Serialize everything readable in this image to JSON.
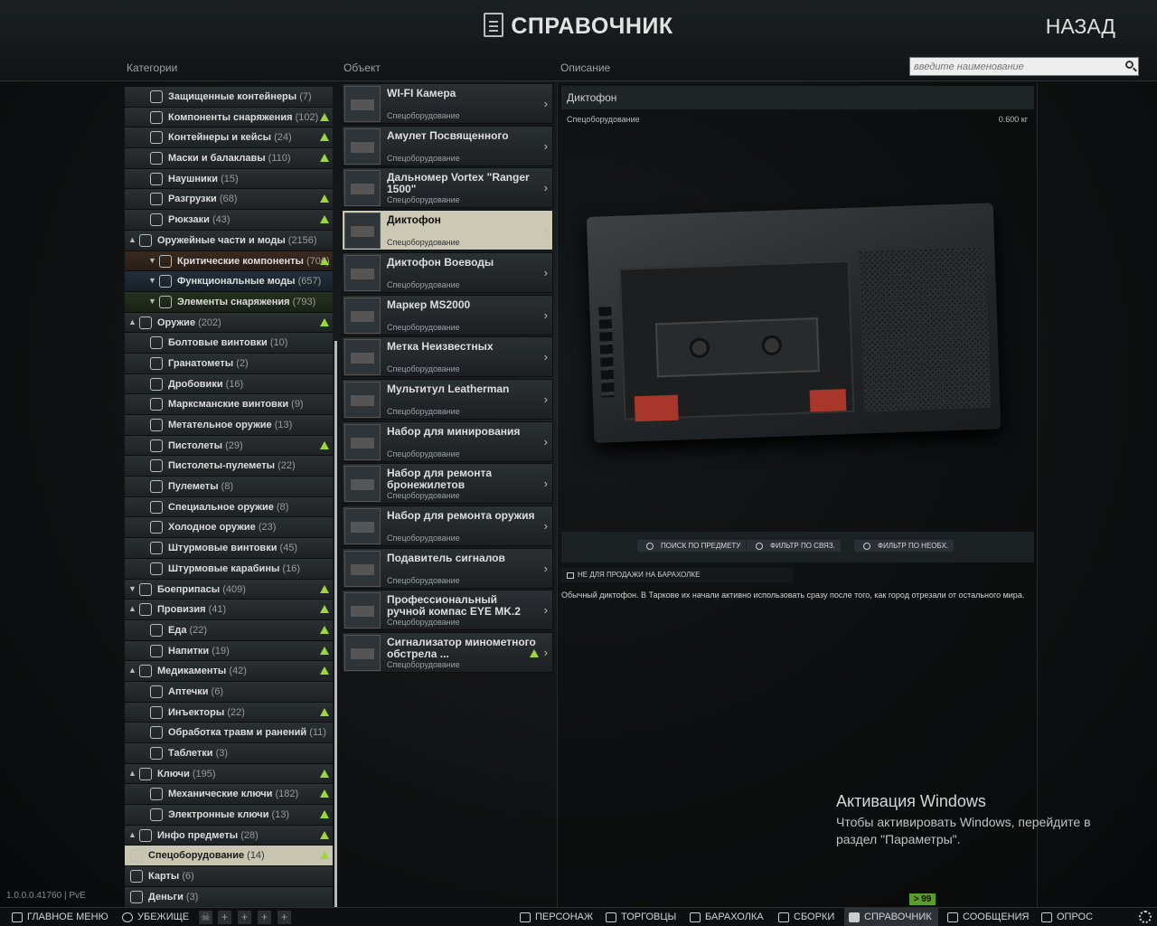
{
  "header": {
    "title": "СПРАВОЧНИК",
    "back_label": "НАЗАД",
    "col_categories": "Категории",
    "col_object": "Объект",
    "col_description": "Описание",
    "search_placeholder": "введите наименование"
  },
  "categories": [
    {
      "label": "Защищенные контейнеры",
      "count": "(7)",
      "level": 1,
      "icon": "container-icon",
      "warn": false
    },
    {
      "label": "Компоненты снаряжения",
      "count": "(102)",
      "level": 1,
      "icon": "gear-part-icon",
      "warn": true
    },
    {
      "label": "Контейнеры и кейсы",
      "count": "(24)",
      "level": 1,
      "icon": "case-icon",
      "warn": true
    },
    {
      "label": "Маски и балаклавы",
      "count": "(110)",
      "level": 1,
      "icon": "mask-icon",
      "warn": true
    },
    {
      "label": "Наушники",
      "count": "(15)",
      "level": 1,
      "icon": "headphones-icon",
      "warn": false
    },
    {
      "label": "Разгрузки",
      "count": "(68)",
      "level": 1,
      "icon": "vest-icon",
      "warn": true
    },
    {
      "label": "Рюкзаки",
      "count": "(43)",
      "level": 1,
      "icon": "backpack-icon",
      "warn": true
    },
    {
      "label": "Оружейные части и моды",
      "count": "(2156)",
      "level": 0,
      "icon": "weapon-mods-icon",
      "warn": false,
      "arrow": "^"
    },
    {
      "label": "Критические компоненты",
      "count": "(706)",
      "level": 2,
      "icon": "critical-icon",
      "warn": true,
      "arrow": "v",
      "style": "gold"
    },
    {
      "label": "Функциональные моды",
      "count": "(657)",
      "level": 2,
      "icon": "functional-icon",
      "warn": false,
      "arrow": "v",
      "style": "blue"
    },
    {
      "label": "Элементы снаряжения",
      "count": "(793)",
      "level": 2,
      "icon": "triangle-icon",
      "warn": false,
      "arrow": "v",
      "style": "green"
    },
    {
      "label": "Оружие",
      "count": "(202)",
      "level": 0,
      "icon": "weapon-icon",
      "warn": true,
      "arrow": "^"
    },
    {
      "label": "Болтовые винтовки",
      "count": "(10)",
      "level": 1,
      "icon": "rifle-icon",
      "warn": false
    },
    {
      "label": "Гранатометы",
      "count": "(2)",
      "level": 1,
      "icon": "launcher-icon",
      "warn": false
    },
    {
      "label": "Дробовики",
      "count": "(16)",
      "level": 1,
      "icon": "shotgun-icon",
      "warn": false
    },
    {
      "label": "Марксманские винтовки",
      "count": "(9)",
      "level": 1,
      "icon": "rifle-icon",
      "warn": false
    },
    {
      "label": "Метательное оружие",
      "count": "(13)",
      "level": 1,
      "icon": "grenade-icon",
      "warn": false
    },
    {
      "label": "Пистолеты",
      "count": "(29)",
      "level": 1,
      "icon": "pistol-icon",
      "warn": true
    },
    {
      "label": "Пистолеты-пулеметы",
      "count": "(22)",
      "level": 1,
      "icon": "smg-icon",
      "warn": false
    },
    {
      "label": "Пулеметы",
      "count": "(8)",
      "level": 1,
      "icon": "mg-icon",
      "warn": false
    },
    {
      "label": "Специальное оружие",
      "count": "(8)",
      "level": 1,
      "icon": "special-weapon-icon",
      "warn": false
    },
    {
      "label": "Холодное оружие",
      "count": "(23)",
      "level": 1,
      "icon": "knife-icon",
      "warn": false
    },
    {
      "label": "Штурмовые винтовки",
      "count": "(45)",
      "level": 1,
      "icon": "assault-rifle-icon",
      "warn": false
    },
    {
      "label": "Штурмовые карабины",
      "count": "(16)",
      "level": 1,
      "icon": "carbine-icon",
      "warn": false
    },
    {
      "label": "Боеприпасы",
      "count": "(409)",
      "level": 0,
      "icon": "ammo-icon",
      "warn": true,
      "arrow": "v"
    },
    {
      "label": "Провизия",
      "count": "(41)",
      "level": 0,
      "icon": "provisions-icon",
      "warn": true,
      "arrow": "^"
    },
    {
      "label": "Еда",
      "count": "(22)",
      "level": 1,
      "icon": "food-icon",
      "warn": true
    },
    {
      "label": "Напитки",
      "count": "(19)",
      "level": 1,
      "icon": "drink-icon",
      "warn": true
    },
    {
      "label": "Медикаменты",
      "count": "(42)",
      "level": 0,
      "icon": "medical-icon",
      "warn": true,
      "arrow": "^"
    },
    {
      "label": "Аптечки",
      "count": "(6)",
      "level": 1,
      "icon": "medkit-icon",
      "warn": false
    },
    {
      "label": "Инъекторы",
      "count": "(22)",
      "level": 1,
      "icon": "injector-icon",
      "warn": true
    },
    {
      "label": "Обработка травм и ранений",
      "count": "(11)",
      "level": 1,
      "icon": "bandage-icon",
      "warn": false
    },
    {
      "label": "Таблетки",
      "count": "(3)",
      "level": 1,
      "icon": "pills-icon",
      "warn": false
    },
    {
      "label": "Ключи",
      "count": "(195)",
      "level": 0,
      "icon": "key-icon",
      "warn": true,
      "arrow": "^"
    },
    {
      "label": "Механические ключи",
      "count": "(182)",
      "level": 1,
      "icon": "key-icon",
      "warn": true
    },
    {
      "label": "Электронные ключи",
      "count": "(13)",
      "level": 1,
      "icon": "keycard-icon",
      "warn": true
    },
    {
      "label": "Инфо предметы",
      "count": "(28)",
      "level": 0,
      "icon": "info-item-icon",
      "warn": true,
      "arrow": "^"
    },
    {
      "label": "Спецоборудование",
      "count": "(14)",
      "level": -1,
      "icon": "special-equipment-icon",
      "warn": true,
      "style": "selected"
    },
    {
      "label": "Карты",
      "count": "(6)",
      "level": -1,
      "icon": "map-icon",
      "warn": false
    },
    {
      "label": "Деньги",
      "count": "(3)",
      "level": -1,
      "icon": "money-icon",
      "warn": false
    }
  ],
  "items": [
    {
      "name": "WI-FI Камера",
      "sub": "Спецоборудование"
    },
    {
      "name": "Амулет Посвященного",
      "sub": "Спецоборудование"
    },
    {
      "name": "Дальномер Vortex \"Ranger 1500\"",
      "sub": "Спецоборудование"
    },
    {
      "name": "Диктофон",
      "sub": "Спецоборудование",
      "selected": true
    },
    {
      "name": "Диктофон Воеводы",
      "sub": "Спецоборудование"
    },
    {
      "name": "Маркер MS2000",
      "sub": "Спецоборудование"
    },
    {
      "name": "Метка Неизвестных",
      "sub": "Спецоборудование"
    },
    {
      "name": "Мультитул Leatherman",
      "sub": "Спецоборудование"
    },
    {
      "name": "Набор для минирования",
      "sub": "Спецоборудование"
    },
    {
      "name": "Набор для ремонта бронежилетов",
      "sub": "Спецоборудование"
    },
    {
      "name": "Набор для ремонта оружия",
      "sub": "Спецоборудование"
    },
    {
      "name": "Подавитель сигналов",
      "sub": "Спецоборудование"
    },
    {
      "name": "Профессиональный ручной компас EYE MK.2",
      "sub": "Спецоборудование"
    },
    {
      "name": "Сигнализатор минометного обстрела ...",
      "sub": "Спецоборудование",
      "warn": true
    }
  ],
  "detail": {
    "name": "Диктофон",
    "category": "Спецоборудование",
    "weight": "0.600 кг",
    "btn_search": "ПОИСК ПО ПРЕДМЕТУ",
    "btn_filter_linked": "ФИЛЬТР ПО СВЯЗ.",
    "btn_filter_required": "ФИЛЬТР ПО НЕОБХ.",
    "not_for_sale": "НЕ ДЛЯ ПРОДАЖИ НА БАРАХОЛКЕ",
    "description": "Обычный диктофон. В Таркове их начали активно использовать сразу после того, как город отрезали от остального мира."
  },
  "version": "1.0.0.0.41760 | PvE",
  "activation": {
    "heading": "Активация Windows",
    "text": "Чтобы активировать Windows, перейдите в раздел \"Параметры\"."
  },
  "badge": "> 99",
  "bottom": {
    "main_menu": "ГЛАВНОЕ МЕНЮ",
    "hideout": "УБЕЖИЩЕ",
    "character": "ПЕРСОНАЖ",
    "traders": "ТОРГОВЦЫ",
    "flea": "БАРАХОЛКА",
    "builds": "СБОРКИ",
    "handbook": "СПРАВОЧНИК",
    "messages": "СООБЩЕНИЯ",
    "survey": "ОПРОС",
    "plus": "+"
  },
  "colors": {
    "accent_selected": "#cbc9b3",
    "warning": "#9ed63e",
    "badge": "#5c9a2a"
  }
}
